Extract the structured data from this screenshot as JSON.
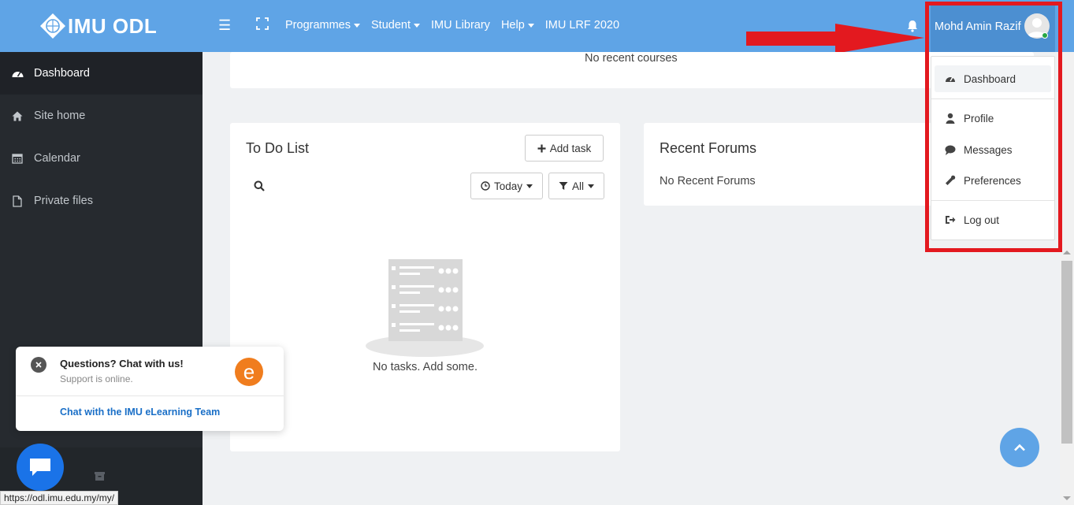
{
  "brand": {
    "name": "IMU ODL"
  },
  "navbar": {
    "toggle_icon": "hamburger-icon",
    "expand_icon": "fullscreen-icon",
    "menu": [
      {
        "label": "Programmes",
        "dropdown": true
      },
      {
        "label": "Student",
        "dropdown": true
      },
      {
        "label": "IMU Library",
        "dropdown": false
      },
      {
        "label": "Help",
        "dropdown": true
      },
      {
        "label": "IMU LRF 2020",
        "dropdown": false
      }
    ],
    "notification_icon": "bell-icon",
    "user": {
      "name": "Mohd Amin Razif",
      "status": "online"
    }
  },
  "user_menu": {
    "items": [
      {
        "label": "Dashboard",
        "icon": "dashboard-icon",
        "active": true
      },
      {
        "label": "Profile",
        "icon": "user-icon"
      },
      {
        "label": "Messages",
        "icon": "comment-icon"
      },
      {
        "label": "Preferences",
        "icon": "wrench-icon"
      },
      {
        "label": "Log out",
        "icon": "sign-out-icon"
      }
    ]
  },
  "sidebar": {
    "items": [
      {
        "label": "Dashboard",
        "icon": "dashboard-icon",
        "active": true
      },
      {
        "label": "Site home",
        "icon": "home-icon"
      },
      {
        "label": "Calendar",
        "icon": "calendar-icon"
      },
      {
        "label": "Private files",
        "icon": "file-icon"
      }
    ]
  },
  "main": {
    "recent_courses": {
      "empty_text": "No recent courses"
    },
    "todo": {
      "title": "To Do List",
      "add_task_label": "Add task",
      "filter_date_label": "Today",
      "filter_type_label": "All",
      "empty_text": "No tasks. Add some."
    },
    "forums": {
      "title": "Recent Forums",
      "empty_text": "No Recent Forums"
    }
  },
  "chat_widget": {
    "title": "Questions? Chat with us!",
    "subtitle": "Support is online.",
    "logo_letter": "e",
    "link_label": "Chat with the IMU eLearning Team"
  },
  "status_bar": {
    "url": "https://odl.imu.edu.my/my/"
  },
  "colors": {
    "navbar": "#5fa4e6",
    "sidebar": "#262a2f",
    "annotation": "#e3191f",
    "chat_button": "#1a73e8"
  }
}
